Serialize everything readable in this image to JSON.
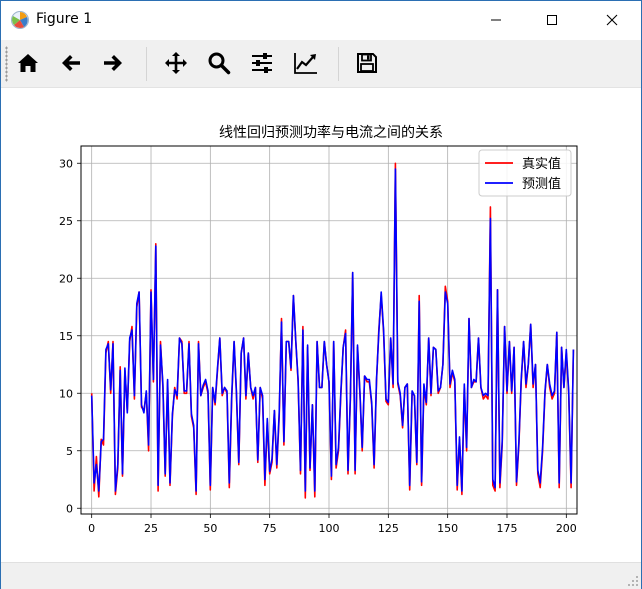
{
  "window": {
    "title": "Figure 1"
  },
  "toolbar": {
    "buttons": [
      "home-icon",
      "back-arrow-icon",
      "forward-arrow-icon",
      "pan-icon",
      "zoom-icon",
      "configure-subplots-icon",
      "edit-axis-icon",
      "save-icon"
    ]
  },
  "chart_data": {
    "type": "line",
    "title": "线性回归预测功率与电流之间的关系",
    "xlim": [
      -4.5,
      204.5
    ],
    "ylim": [
      -0.5,
      31.5
    ],
    "xticks": [
      0,
      25,
      50,
      75,
      100,
      125,
      150,
      175,
      200
    ],
    "yticks": [
      0,
      5,
      10,
      15,
      20,
      25,
      30
    ],
    "grid": true,
    "legend_position": "upper right",
    "series": [
      {
        "name": "真实值",
        "color": "#ff0000",
        "values": [
          10,
          1.5,
          4.5,
          1,
          6,
          5.5,
          13.5,
          14.5,
          10,
          14.5,
          1.2,
          3.5,
          12.3,
          2.8,
          12,
          8.5,
          14.5,
          15.8,
          9.5,
          17.5,
          18.8,
          8.8,
          8.5,
          10,
          5,
          19,
          11,
          23,
          1.5,
          14.5,
          10.5,
          2.8,
          11,
          2,
          8,
          10.5,
          9.5,
          14.8,
          14.5,
          10,
          10,
          14.5,
          8,
          7,
          1.2,
          14.5,
          9.8,
          10.5,
          11,
          10,
          1.6,
          10.5,
          9,
          12,
          14.8,
          9.8,
          10.5,
          10,
          1.8,
          9.5,
          14.5,
          10,
          3.8,
          13.5,
          14.8,
          9.5,
          13.5,
          10.5,
          9.5,
          10.5,
          4,
          10.5,
          9.5,
          2,
          7.5,
          3,
          4,
          8.5,
          3.5,
          8,
          16.5,
          5.5,
          14.5,
          14.5,
          12,
          18.5,
          14.5,
          11,
          3,
          15.8,
          0.9,
          14,
          3.3,
          9,
          1,
          14.5,
          10.5,
          10.5,
          14.5,
          12.5,
          11,
          2.5,
          14.5,
          3.5,
          5,
          10,
          14,
          15.5,
          3,
          9.5,
          20.5,
          3,
          14,
          10,
          5,
          11.5,
          11,
          11,
          9,
          3.5,
          11,
          15.5,
          18.5,
          15.3,
          9.3,
          9,
          14.8,
          10.5,
          30,
          10.8,
          9.8,
          7,
          10.5,
          10.8,
          1.6,
          10,
          9.8,
          3.8,
          18.5,
          2,
          10.5,
          9,
          14.8,
          9.8,
          14,
          13.8,
          10,
          10.5,
          12.5,
          19.3,
          18,
          10.5,
          11.8,
          11,
          1.6,
          6,
          1.2,
          10.5,
          5,
          16.5,
          10.5,
          11,
          11,
          14.8,
          10.5,
          9.5,
          9.8,
          9.5,
          26.2,
          2,
          1.5,
          19,
          1.8,
          5.5,
          15.8,
          10,
          14.5,
          10,
          14,
          2,
          5.5,
          11,
          14.5,
          10.5,
          12.5,
          16,
          10.5,
          12.5,
          3,
          1.8,
          5,
          10,
          12.5,
          10.5,
          9.5,
          10,
          15.3,
          1.8,
          14,
          10.5,
          13.5,
          10,
          1.8,
          13.8
        ]
      },
      {
        "name": "预测值",
        "color": "#0000ff",
        "values": [
          9.8,
          2.2,
          3.8,
          1.5,
          5.8,
          6,
          13.8,
          14.3,
          10.3,
          14.3,
          1.5,
          3.8,
          12,
          3,
          12.2,
          8.3,
          14.8,
          15.5,
          9.8,
          17.8,
          18.8,
          9,
          8.3,
          10.2,
          5.5,
          18.8,
          11.2,
          22.8,
          2,
          14.2,
          10.8,
          3,
          11.2,
          2.2,
          8.2,
          10.3,
          9.8,
          14.8,
          14.3,
          10.2,
          10.2,
          14.3,
          8.2,
          7.2,
          1.5,
          14.3,
          9.8,
          10.7,
          11.2,
          10.2,
          2,
          10.5,
          9.2,
          12.2,
          14.8,
          10,
          10.5,
          10.2,
          2.2,
          9.8,
          14.5,
          10.2,
          4,
          13.5,
          14.8,
          9.8,
          13.5,
          10.5,
          9.8,
          10.5,
          4.2,
          10.5,
          9.8,
          2.5,
          7.8,
          3.2,
          4.3,
          8.5,
          3.8,
          8.3,
          16.2,
          5.8,
          14.5,
          14.5,
          12.2,
          18.5,
          14.5,
          11.2,
          3.3,
          15.5,
          1.5,
          14.2,
          3.5,
          9,
          1.5,
          14.5,
          10.5,
          10.5,
          14.5,
          12.5,
          11,
          2.8,
          14.5,
          3.8,
          5.3,
          10.2,
          14,
          15.2,
          3.3,
          9.8,
          20.5,
          3.3,
          14.2,
          10.2,
          5.3,
          11.5,
          11.2,
          11.2,
          9.2,
          3.8,
          11.2,
          15.2,
          18.8,
          15.5,
          9.5,
          9.2,
          14.8,
          10.8,
          29.5,
          11,
          10,
          7.2,
          10.5,
          10.8,
          2,
          10.2,
          9.8,
          4,
          18,
          2.3,
          10.8,
          9.2,
          14.8,
          10,
          14,
          13.8,
          10.2,
          10.5,
          12.5,
          18.8,
          17.8,
          10.8,
          12,
          11.2,
          2,
          6.2,
          1.5,
          10.8,
          5.3,
          16.5,
          10.5,
          11.2,
          11,
          14.8,
          10.5,
          9.8,
          10,
          9.8,
          25.2,
          2.5,
          1.8,
          19,
          2.2,
          5.8,
          15.8,
          10.2,
          14.5,
          10.2,
          14,
          2.3,
          5.8,
          11.2,
          14.5,
          10.8,
          12.5,
          16,
          10.8,
          12.5,
          3.3,
          2.2,
          5.3,
          10.2,
          12.5,
          10.8,
          9.8,
          10.2,
          15.3,
          2.2,
          14,
          10.5,
          13.8,
          10.2,
          2.2,
          13.8
        ]
      }
    ]
  }
}
